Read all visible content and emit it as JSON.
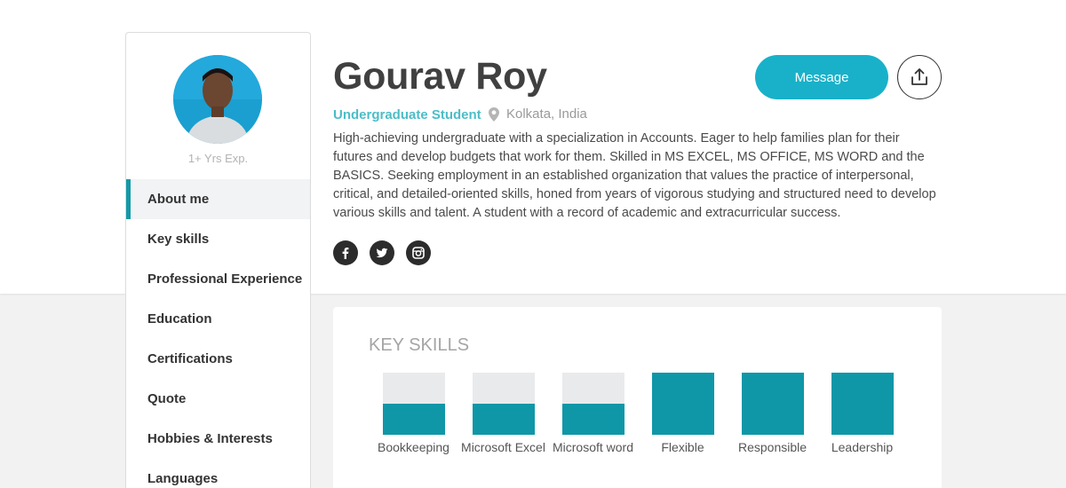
{
  "profile": {
    "name": "Gourav Roy",
    "role": "Undergraduate Student",
    "location": "Kolkata, India",
    "experience": "1+ Yrs Exp.",
    "bio": "High-achieving undergraduate with a specialization in Accounts. Eager to help families plan for their futures and develop budgets that work for them. Skilled in MS EXCEL, MS OFFICE, MS WORD and the BASICS. Seeking employment in an established organization that values the practice of interpersonal, critical, and detailed-oriented skills, honed from years of vigorous studying and structured need to develop various skills and talent. A student with a record of academic and extracurricular success."
  },
  "actions": {
    "message_label": "Message"
  },
  "sidebar": {
    "items": [
      {
        "label": "About me",
        "active": true
      },
      {
        "label": "Key skills",
        "active": false
      },
      {
        "label": "Professional Experience",
        "active": false
      },
      {
        "label": "Education",
        "active": false
      },
      {
        "label": "Certifications",
        "active": false
      },
      {
        "label": "Quote",
        "active": false
      },
      {
        "label": "Hobbies & Interests",
        "active": false
      },
      {
        "label": "Languages",
        "active": false
      }
    ]
  },
  "socials": [
    "facebook-icon",
    "twitter-icon",
    "instagram-icon"
  ],
  "key_skills": {
    "title": "KEY SKILLS",
    "items": [
      {
        "label": "Bookkeeping",
        "level": 0.5
      },
      {
        "label": "Microsoft Excel",
        "level": 0.5
      },
      {
        "label": "Microsoft word",
        "level": 0.5
      },
      {
        "label": "Flexible",
        "level": 1.0
      },
      {
        "label": "Responsible",
        "level": 1.0
      },
      {
        "label": "Leadership",
        "level": 1.0
      }
    ]
  },
  "colors": {
    "accent": "#19b1c9",
    "skill_fill": "#0f97a8",
    "skill_track": "#e9eaec",
    "role_text": "#4bbdc8"
  }
}
